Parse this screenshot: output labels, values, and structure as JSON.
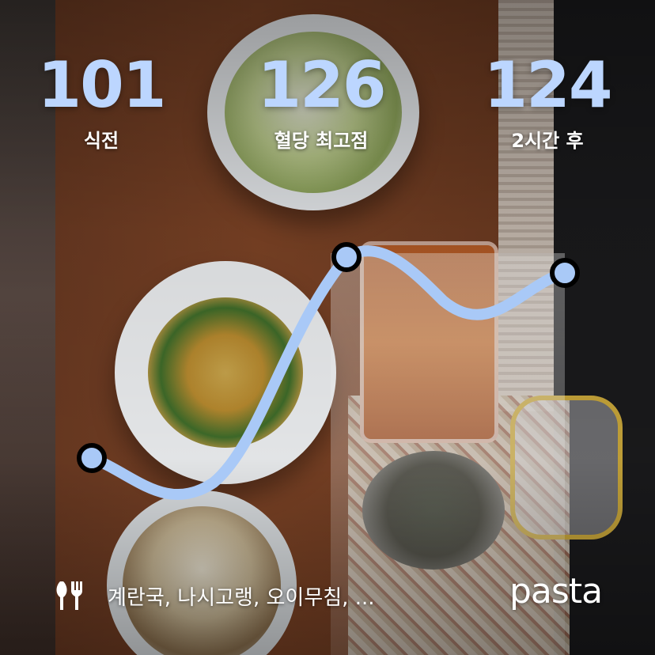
{
  "stats": [
    {
      "value": "101",
      "label": "식전"
    },
    {
      "value": "126",
      "label": "혈당 최고점"
    },
    {
      "value": "124",
      "label": "2시간 후"
    }
  ],
  "meal": {
    "icon": "fork-knife-icon",
    "foods": "계란국, 나시고랭, 오이무침, ..."
  },
  "brand": "pasta",
  "colors": {
    "accent": "#bcd6ff",
    "curve": "#a9c9f7",
    "marker_fill": "#a9c9f7",
    "marker_stroke": "#000000"
  }
}
